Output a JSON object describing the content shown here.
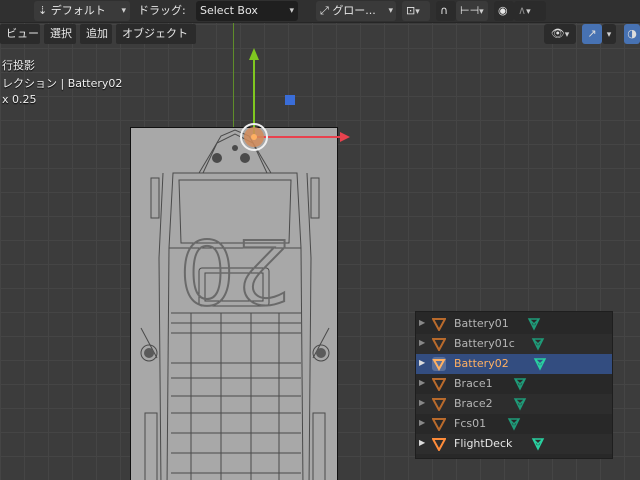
{
  "header": {
    "mode_label": "デフォルト",
    "drag_label": "ドラッグ:",
    "select_mode": "Select Box",
    "transform_label": "グロー..."
  },
  "menubar": {
    "view": "ビュー",
    "select": "選択",
    "add": "追加",
    "object": "オブジェクト"
  },
  "viewport_info": {
    "projection": "行投影",
    "collection": "レクション | Battery02",
    "scale": "x 0.25"
  },
  "model": {
    "hull_number": "20"
  },
  "outliner": {
    "items": [
      {
        "name": "Battery01",
        "state": "dim"
      },
      {
        "name": "Battery01c",
        "state": "dim"
      },
      {
        "name": "Battery02",
        "state": "selected"
      },
      {
        "name": "Brace1",
        "state": "dim"
      },
      {
        "name": "Brace2",
        "state": "dim"
      },
      {
        "name": "Fcs01",
        "state": "dim"
      },
      {
        "name": "FlightDeck",
        "state": "visible"
      }
    ]
  },
  "colors": {
    "selection": "#334d80",
    "object_orange": "#ff8c3a",
    "mesh_green": "#29d0a0",
    "x_axis": "#e8424e",
    "y_axis": "#7fc720"
  }
}
